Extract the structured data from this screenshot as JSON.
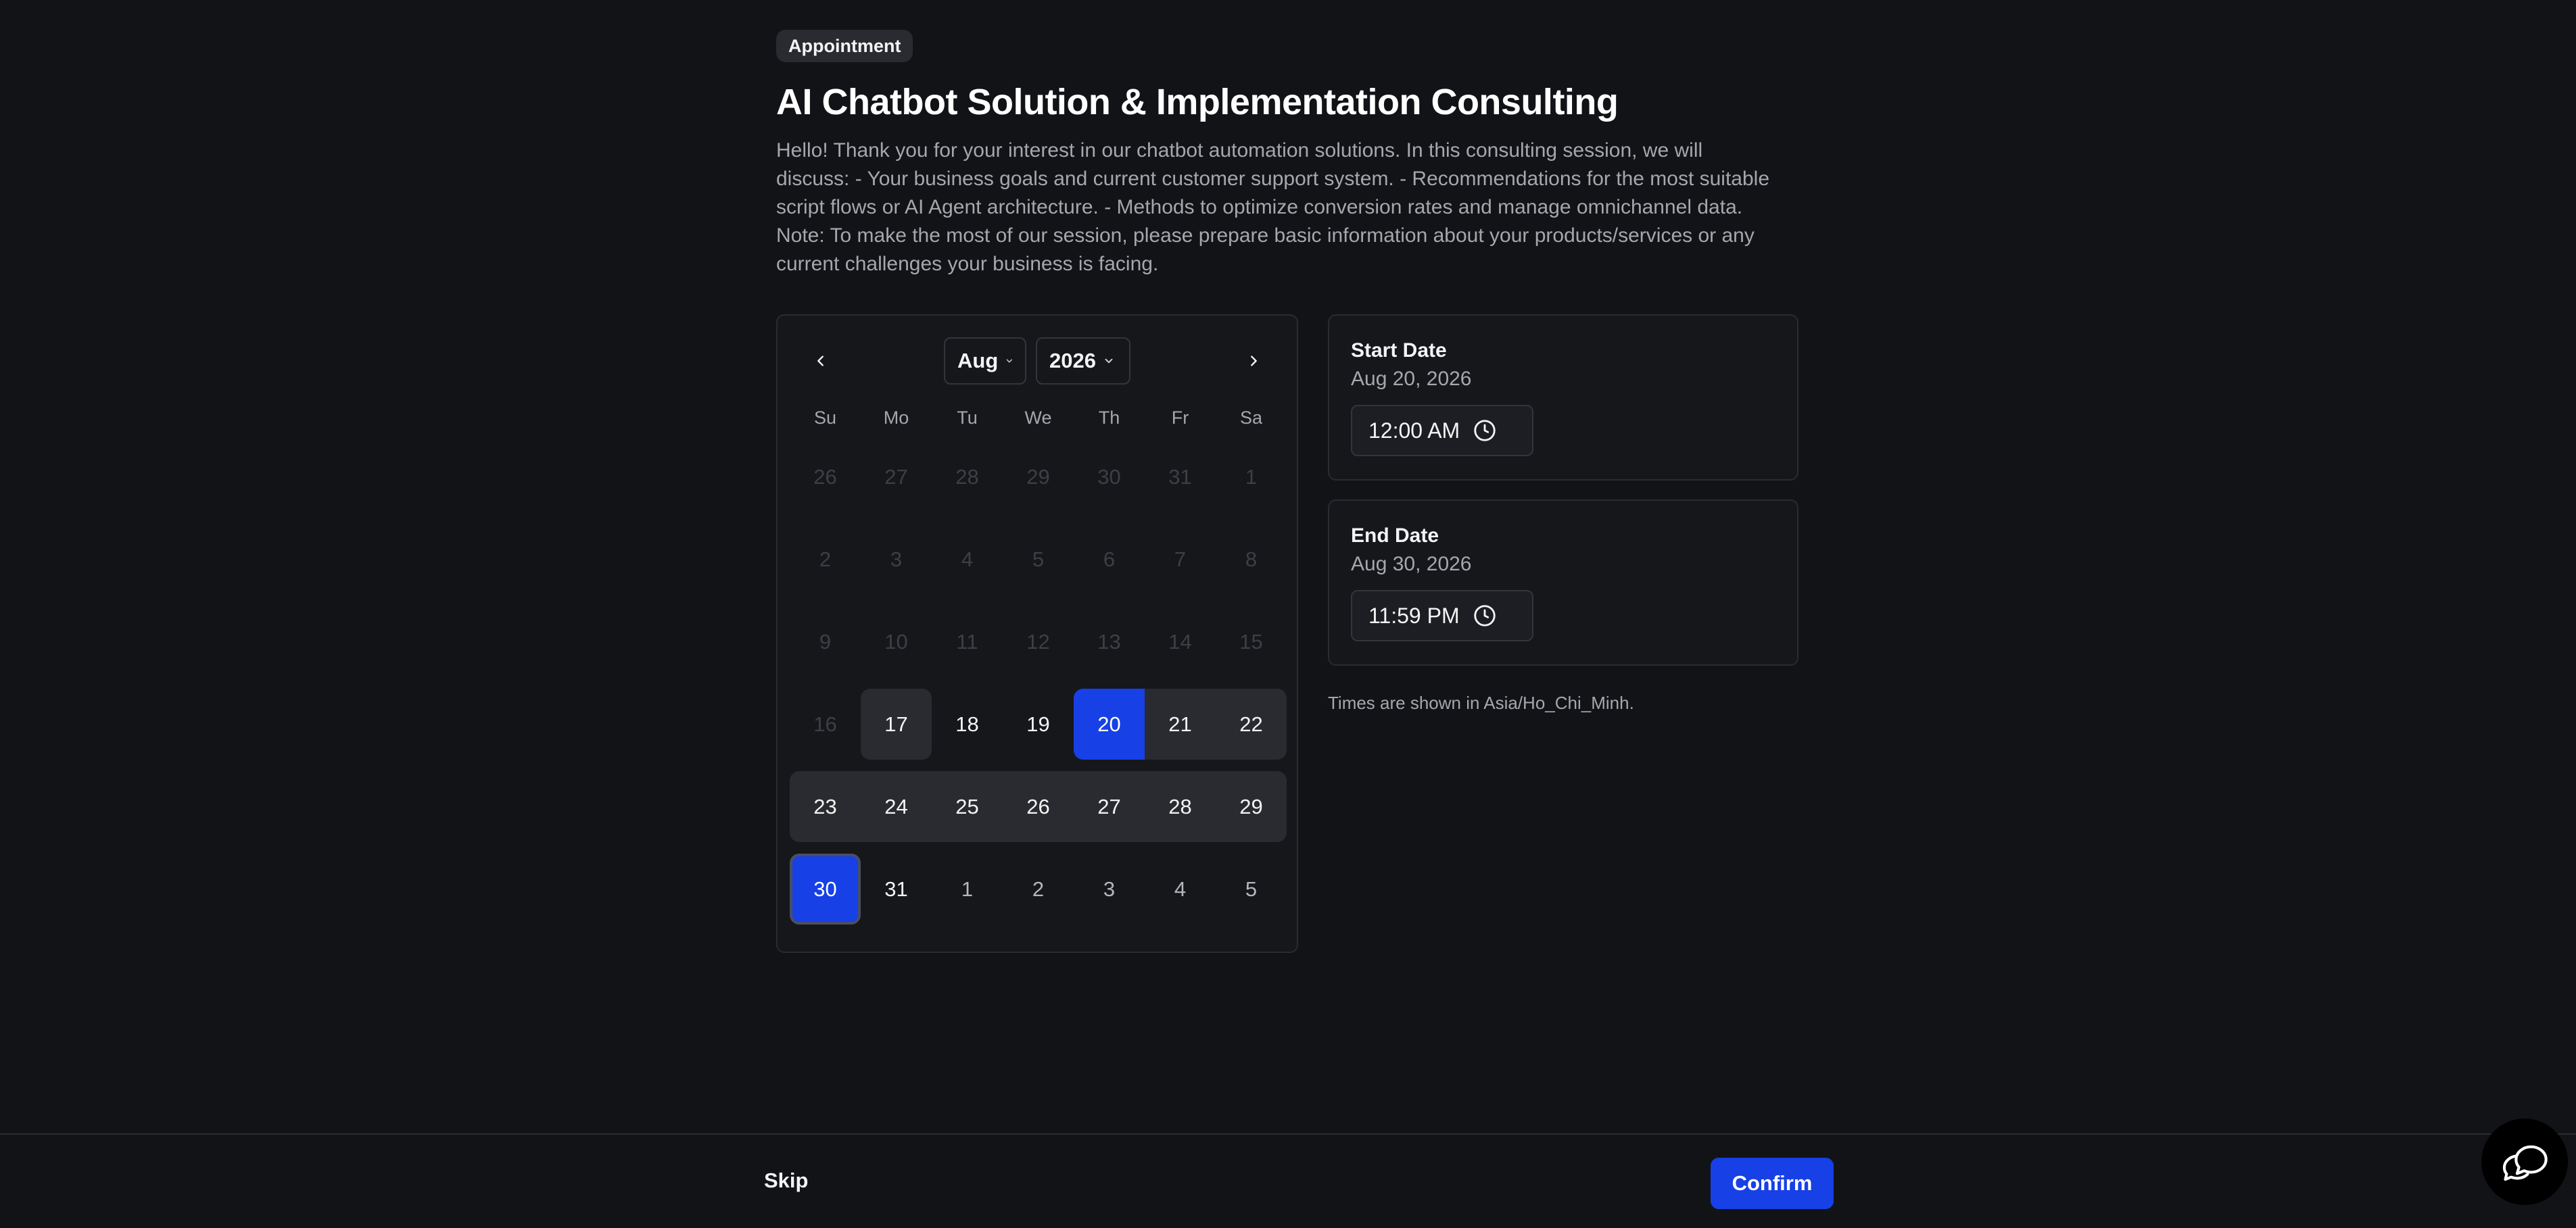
{
  "badge": "Appointment",
  "title": "AI Chatbot Solution & Implementation Consulting",
  "description": "Hello! Thank you for your interest in our chatbot automation solutions. In this consulting session, we will discuss: - Your business goals and current customer support system. - Recommendations for the most suitable script flows or AI Agent architecture. - Methods to optimize conversion rates and manage omnichannel data. Note: To make the most of our session, please prepare basic information about your products/services or any current challenges your business is facing.",
  "calendar": {
    "month": "Aug",
    "year": "2026",
    "weekdays": [
      "Su",
      "Mo",
      "Tu",
      "We",
      "Th",
      "Fr",
      "Sa"
    ],
    "weeks": [
      [
        "26",
        "27",
        "28",
        "29",
        "30",
        "31",
        "1"
      ],
      [
        "2",
        "3",
        "4",
        "5",
        "6",
        "7",
        "8"
      ],
      [
        "9",
        "10",
        "11",
        "12",
        "13",
        "14",
        "15"
      ],
      [
        "16",
        "17",
        "18",
        "19",
        "20",
        "21",
        "22"
      ],
      [
        "23",
        "24",
        "25",
        "26",
        "27",
        "28",
        "29"
      ],
      [
        "30",
        "31",
        "1",
        "2",
        "3",
        "4",
        "5"
      ]
    ]
  },
  "start": {
    "label": "Start Date",
    "date": "Aug 20, 2026",
    "time": "12:00 AM"
  },
  "end": {
    "label": "End Date",
    "date": "Aug 30, 2026",
    "time": "11:59 PM"
  },
  "timezone_note": "Times are shown in Asia/Ho_Chi_Minh.",
  "footer": {
    "skip": "Skip",
    "confirm": "Confirm"
  },
  "colors": {
    "accent": "#1740e6",
    "background": "#121317"
  }
}
